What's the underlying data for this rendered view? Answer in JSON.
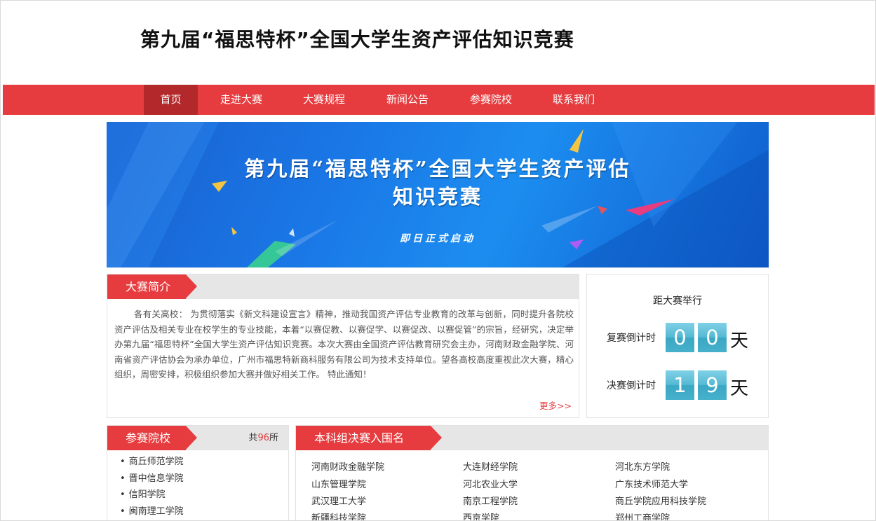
{
  "header": {
    "title": "第九届“福思特杯”全国大学生资产评估知识竞赛"
  },
  "nav": {
    "items": [
      "首页",
      "走进大赛",
      "大赛规程",
      "新闻公告",
      "参赛院校",
      "联系我们"
    ],
    "active_index": 0
  },
  "banner": {
    "title_line1": "第九届“福思特杯”全国大学生资产评估",
    "title_line2": "知识竞赛",
    "subtitle": "即日正式启动"
  },
  "intro": {
    "heading": "大赛简介",
    "body": "各有关高校： 为贯彻落实《新文科建设宣言》精神，推动我国资产评估专业教育的改革与创新，同时提升各院校资产评估及相关专业在校学生的专业技能，本着“以赛促教、以赛促学、以赛促改、以赛促管”的宗旨，经研究，决定举办第九届“福思特杯”全国大学生资产评估知识竞赛。本次大赛由全国资产评估教育研究会主办，河南财政金融学院、河南省资产评估协会为承办单位，广州市福思特新商科服务有限公司为技术支持单位。望各高校高度重视此次大赛，精心组织，周密安排，积极组织参加大赛并做好相关工作。 特此通知！",
    "more": "更多>>"
  },
  "countdown": {
    "title": "距大赛举行",
    "semifinal": {
      "label": "复赛倒计时",
      "digits": [
        "0",
        "0"
      ],
      "unit": "天"
    },
    "final": {
      "label": "决赛倒计时",
      "digits": [
        "1",
        "9"
      ],
      "unit": "天"
    }
  },
  "schools": {
    "heading": "参赛院校",
    "count_prefix": "共",
    "count": "96",
    "count_suffix": "所",
    "list": [
      "商丘师范学院",
      "晋中信息学院",
      "信阳学院",
      "闽南理工学院"
    ]
  },
  "finalists": {
    "heading": "本科组决赛入围名单",
    "columns": [
      [
        "河南财政金融学院",
        "山东管理学院",
        "武汉理工大学",
        "新疆科技学院"
      ],
      [
        "大连财经学院",
        "河北农业大学",
        "南京工程学院",
        "西京学院"
      ],
      [
        "河北东方学院",
        "广东技术师范大学",
        "商丘学院应用科技学院",
        "郑州工商学院"
      ]
    ]
  },
  "colors": {
    "brand_red": "#e63c3f",
    "nav_active": "#b3282b",
    "digit_blue": "#4fb6d0"
  }
}
